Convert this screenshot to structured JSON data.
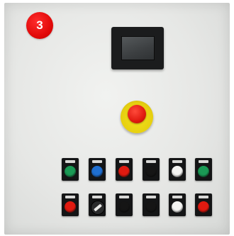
{
  "badge": {
    "number": "3"
  },
  "panel_colors": {
    "badge": "#e20a0a",
    "panel": "#e6e7e5",
    "hmi": "#1b1c1d",
    "estop_ring": "#e6cf10",
    "estop_head": "#e01a10"
  },
  "buttons": [
    {
      "type": "pushbutton",
      "color": "#1a9a55"
    },
    {
      "type": "pushbutton",
      "color": "#1f6fd1"
    },
    {
      "type": "pushbutton",
      "color": "#e01a10"
    },
    {
      "type": "pushbutton",
      "color": "#151515"
    },
    {
      "type": "pushbutton",
      "color": "#f4f4f2"
    },
    {
      "type": "pushbutton",
      "color": "#1a9a55"
    },
    {
      "type": "pushbutton",
      "color": "#e01a10"
    },
    {
      "type": "selector",
      "color": "#2a2b2c"
    },
    {
      "type": "pushbutton",
      "color": "#151515"
    },
    {
      "type": "pushbutton",
      "color": "#151515"
    },
    {
      "type": "pushbutton",
      "color": "#f4f4f2"
    },
    {
      "type": "pushbutton",
      "color": "#e01a10"
    }
  ]
}
